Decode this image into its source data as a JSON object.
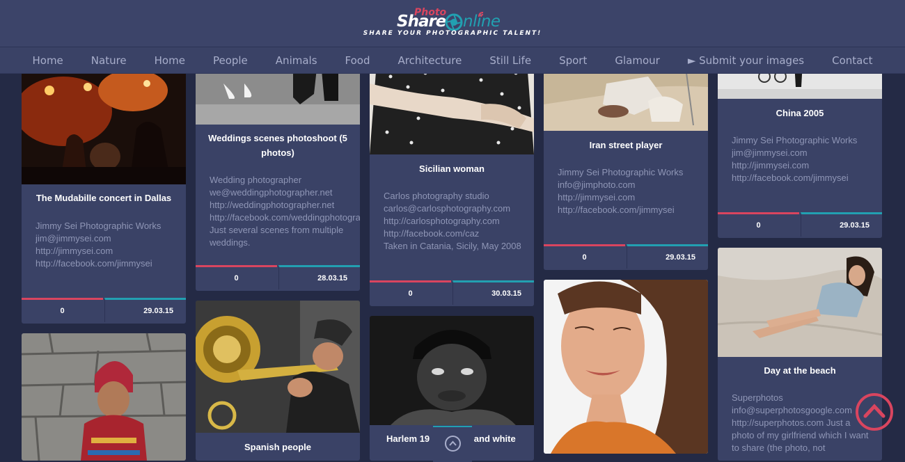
{
  "logo": {
    "photo": "Photo",
    "share": "Share",
    "online": "nline",
    "tagline": "SHARE YOUR PHOTOGRAPHIC TALENT!"
  },
  "nav": {
    "items": [
      "Home",
      "Nature",
      "Home",
      "People",
      "Animals",
      "Food",
      "Architecture",
      "Still Life",
      "Sport",
      "Glamour",
      "► Submit your images",
      "Contact"
    ]
  },
  "cards": [
    {
      "title": "The Mudabille concert in Dallas",
      "desc": "Jimmy Sei Photographic Works\njim@jimmysei.com\nhttp://jimmysei.com\nhttp://facebook.com/jimmysei",
      "likes": "0",
      "date": "29.03.15"
    },
    {
      "title": "",
      "desc": "",
      "likes": "",
      "date": ""
    },
    {
      "title": "Weddings scenes photoshoot (5 photos)",
      "desc": "Wedding photographer\nwe@weddingphotographer.net\nhttp://weddingphotographer.net\nhttp://facebook.com/weddingphotographer\nJust several scenes from multiple weddings.",
      "likes": "0",
      "date": "28.03.15"
    },
    {
      "title": "Spanish people",
      "desc": "",
      "likes": "",
      "date": ""
    },
    {
      "title": "Sicilian woman",
      "desc": "Carlos photography studio\ncarlos@carlosphotography.com\nhttp://carlosphotography.com\nhttp://facebook.com/caz\nTaken in Catania, Sicily, May 2008",
      "likes": "0",
      "date": "30.03.15"
    },
    {
      "title": "Harlem 19",
      "title2": "and white",
      "desc": "",
      "likes": "",
      "date": ""
    },
    {
      "title": "Iran street player",
      "desc": "Jimmy Sei Photographic Works\ninfo@jimphoto.com\nhttp://jimmysei.com\nhttp://facebook.com/jimmysei",
      "likes": "0",
      "date": "29.03.15"
    },
    {
      "title": "",
      "desc": "",
      "likes": "",
      "date": ""
    },
    {
      "title": "China 2005",
      "desc": "Jimmy Sei Photographic Works\njim@jimmysei.com\nhttp://jimmysei.com\nhttp://facebook.com/jimmysei",
      "likes": "0",
      "date": "29.03.15"
    },
    {
      "title": "Day at the beach",
      "desc": "Superphotos\ninfo@superphotosgoogle.com\nhttp://superphotos.com Just a photo of my girlfriend which I want to share (the photo, not",
      "likes": "",
      "date": ""
    }
  ],
  "colors": {
    "background": "#242a45",
    "card": "#3a4266",
    "accent_red": "#d9455f",
    "accent_teal": "#22a0b1"
  },
  "icons": {
    "scroll_top": "chevron-up-circle-icon",
    "tab_up": "chevron-up-icon",
    "aperture": "camera-aperture-icon"
  }
}
